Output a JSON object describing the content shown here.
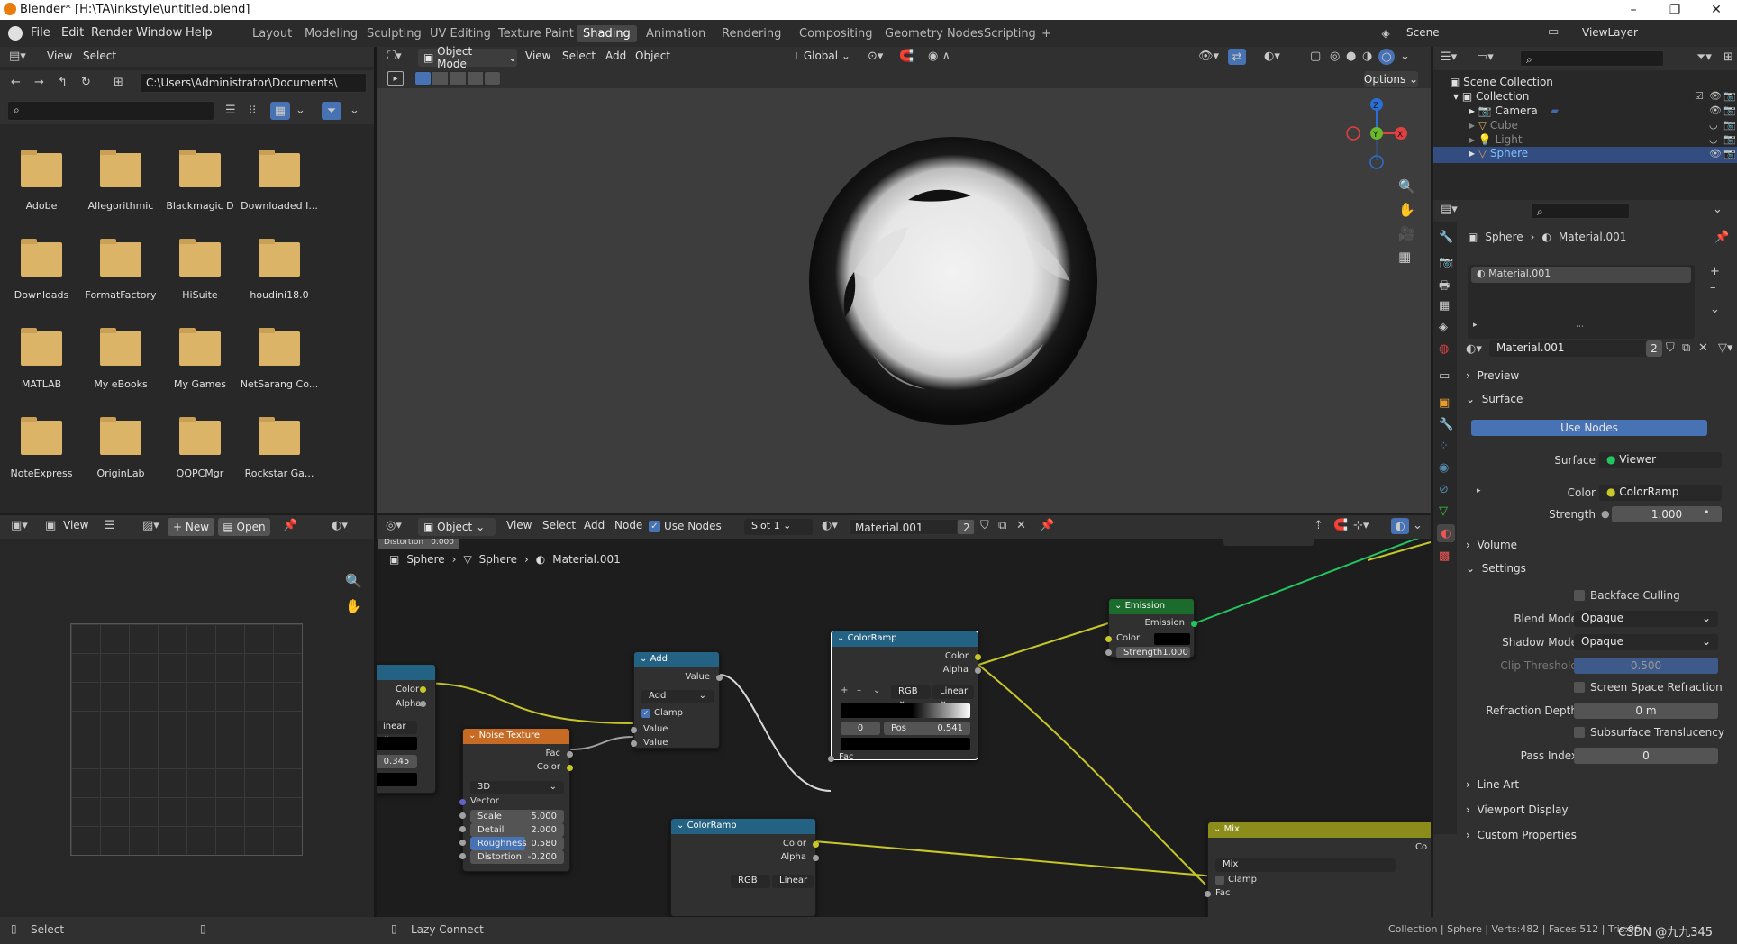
{
  "window": {
    "title": "Blender* [H:\\TA\\inkstyle\\untitled.blend]",
    "min": "–",
    "max": "❐",
    "close": "✕"
  },
  "menu": [
    "File",
    "Edit",
    "Render",
    "Window",
    "Help"
  ],
  "workspaces": [
    "Layout",
    "Modeling",
    "Sculpting",
    "UV Editing",
    "Texture Paint",
    "Shading",
    "Animation",
    "Rendering",
    "Compositing",
    "Geometry Nodes",
    "Scripting",
    "+"
  ],
  "active_workspace": "Shading",
  "scene": "Scene",
  "viewlayer": "ViewLayer",
  "filebrowser": {
    "menu": [
      "View",
      "Select"
    ],
    "path": "C:\\Users\\Administrator\\Documents\\",
    "folders": [
      "Adobe",
      "Allegorithmic",
      "Blackmagic D",
      "Downloaded I...",
      "Downloads",
      "FormatFactory",
      "HiSuite",
      "houdini18.0",
      "MATLAB",
      "My eBooks",
      "My Games",
      "NetSarang Co...",
      "NoteExpress",
      "OriginLab",
      "QQPCMgr",
      "Rockstar Ga..."
    ]
  },
  "viewport": {
    "mode": "Object Mode",
    "menu": [
      "View",
      "Select",
      "Add",
      "Object"
    ],
    "transform": "Global",
    "options": "Options",
    "gizmo": {
      "x": "X",
      "y": "Y",
      "z": "Z"
    }
  },
  "imageeditor": {
    "view": "View",
    "new": "New",
    "open": "Open"
  },
  "nodeeditor": {
    "type": "Object",
    "menu": [
      "View",
      "Select",
      "Add",
      "Node"
    ],
    "use_nodes": "Use Nodes",
    "slot": "Slot 1",
    "material": "Material.001",
    "users": "2",
    "breadcrumb": [
      "Sphere",
      "Sphere",
      "Material.001"
    ],
    "distortion_top": "Distortion",
    "distortion_top_val": "0.000"
  },
  "nodes": {
    "add": {
      "title": "Add",
      "out": "Value",
      "op": "Add",
      "clamp": "Clamp",
      "in1": "Value",
      "in2": "Value"
    },
    "noise": {
      "title": "Noise Texture",
      "fac": "Fac",
      "color": "Color",
      "dim": "3D",
      "vector": "Vector",
      "scale": "Scale",
      "scale_v": "5.000",
      "detail": "Detail",
      "detail_v": "2.000",
      "rough": "Roughness",
      "rough_v": "0.580",
      "dist": "Distortion",
      "dist_v": "-0.200"
    },
    "ramp": {
      "title": "ColorRamp",
      "color": "Color",
      "alpha": "Alpha",
      "mode": "RGB",
      "interp": "Linear",
      "idx": "0",
      "pos": "Pos",
      "pos_v": "0.541",
      "fac": "Fac"
    },
    "ramp2": {
      "title": "ColorRamp",
      "color": "Color",
      "alpha": "Alpha",
      "mode": "RGB",
      "interp": "Linear"
    },
    "emission": {
      "title": "Emission",
      "out": "Emission",
      "color": "Color",
      "strength": "Strength",
      "strength_v": "1.000"
    },
    "mix": {
      "title": "Mix",
      "mode": "Mix",
      "clamp": "Clamp",
      "fac": "Fac",
      "color": "Co"
    },
    "left": {
      "color": "Color",
      "alpha": "Alpha",
      "interp": "inear",
      "val": "0.345"
    }
  },
  "outliner": {
    "scene_collection": "Scene Collection",
    "collection": "Collection",
    "items": [
      "Camera",
      "Cube",
      "Light",
      "Sphere"
    ]
  },
  "properties": {
    "object": "Sphere",
    "material": "Material.001",
    "slot": "Material.001",
    "mat_field": "Material.001",
    "users": "2",
    "preview": "Preview",
    "surface_sec": "Surface",
    "use_nodes": "Use Nodes",
    "surface_lbl": "Surface",
    "surface_val": "Viewer",
    "color_lbl": "Color",
    "color_val": "ColorRamp",
    "strength_lbl": "Strength",
    "strength_val": "1.000",
    "volume": "Volume",
    "settings": "Settings",
    "backface": "Backface Culling",
    "blend_lbl": "Blend Mode",
    "blend_val": "Opaque",
    "shadow_lbl": "Shadow Mode",
    "shadow_val": "Opaque",
    "clip_lbl": "Clip Threshold",
    "clip_val": "0.500",
    "ssr": "Screen Space Refraction",
    "refr_lbl": "Refraction Depth",
    "refr_val": "0 m",
    "sss": "Subsurface Translucency",
    "pass_lbl": "Pass Index",
    "pass_val": "0",
    "line_art": "Line Art",
    "viewport_display": "Viewport Display",
    "custom": "Custom Properties"
  },
  "status": {
    "select": "Select",
    "lazy": "Lazy Connect",
    "stats": "Collection | Sphere | Verts:482 | Faces:512 | Tris:96",
    "watermark": "CSDN @九九345"
  },
  "colors": {
    "accent": "#4772b3",
    "socket_yellow": "#c7c729",
    "socket_gray": "#a1a1a1",
    "socket_purple": "#6363c7",
    "link_green": "#22c55e"
  }
}
